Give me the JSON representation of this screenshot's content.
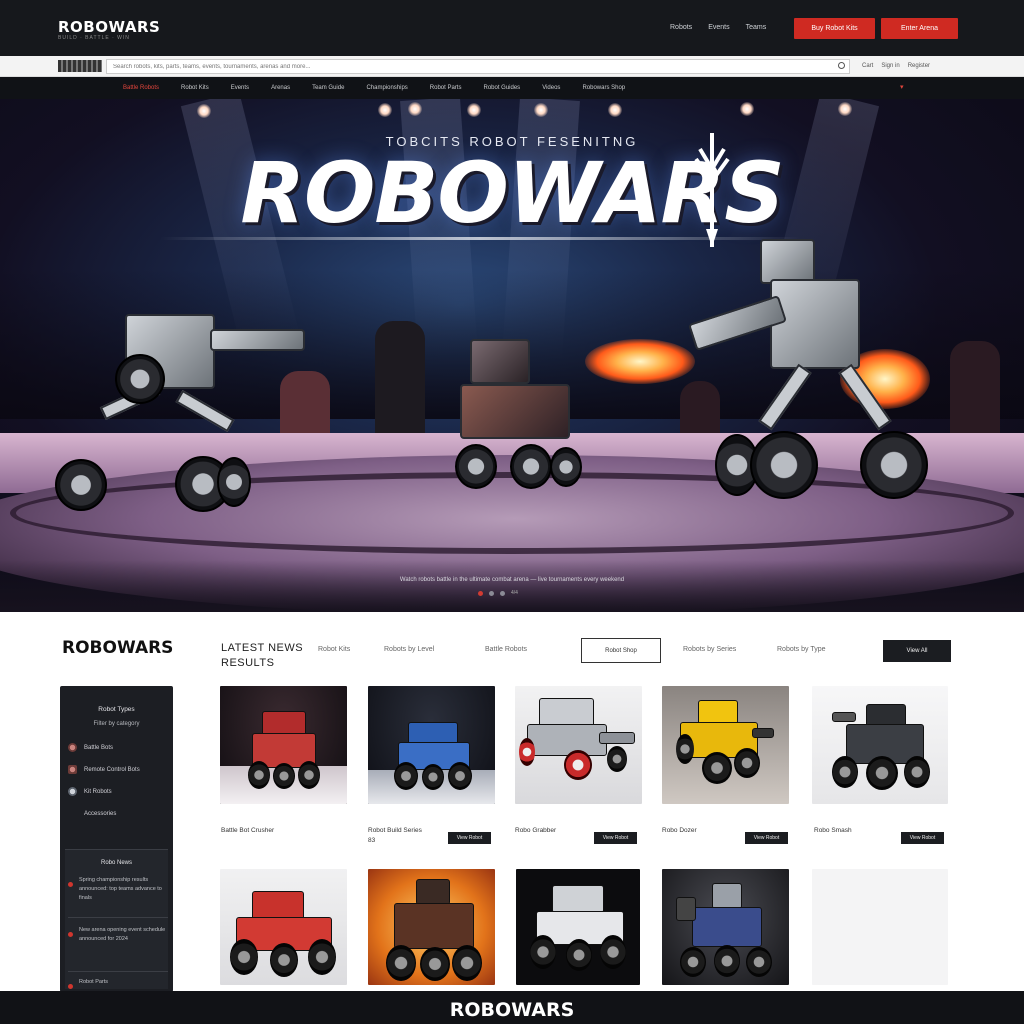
{
  "header": {
    "logo": "ROBOWARS",
    "logo_sub": "BUILD · BATTLE · WIN",
    "links": [
      "Robots",
      "Events",
      "Teams"
    ],
    "cta_primary": "Buy Robot Kits",
    "cta_secondary": "Enter Arena"
  },
  "search": {
    "placeholder": "Search robots, kits, parts, teams, events, tournaments, arenas and more...",
    "right_links": [
      "Cart",
      "Sign in",
      "Register"
    ]
  },
  "nav": {
    "items": [
      "Battle Robots",
      "Robot Kits",
      "Events",
      "Arenas",
      "Team Guide",
      "Championships",
      "Robot Parts",
      "Robot Guides",
      "Videos",
      "Robowars Shop"
    ],
    "active_index": 0
  },
  "hero": {
    "tagline": "TOBCITS ROBOT FESENITNG",
    "title": "ROBOWARS",
    "caption": "Watch robots battle in the ultimate combat arena — live tournaments every weekend",
    "slides": 4,
    "active_slide": 0,
    "slide_label": "4/4"
  },
  "section": {
    "logo": "ROBOWARS",
    "title_line1": "LATEST NEWS",
    "title_line2": "RESULTS",
    "filters": [
      "Robot Kits",
      "Robots by Level",
      "Battle Robots",
      "Robots by Series",
      "Robots by Type"
    ],
    "outline_button": "Robot Shop",
    "dark_button": "View All"
  },
  "sidebar": {
    "heading": "Robot Types",
    "subheading": "Filter by category",
    "items": [
      "Battle Bots",
      "Remote Control Bots",
      "Kit Robots",
      "Accessories"
    ],
    "news_heading": "Robo News",
    "news": [
      "Spring championship results announced: top teams advance to finals",
      "New arena opening event schedule announced for 2024",
      "Robot Parts"
    ]
  },
  "products": [
    {
      "name": "Battle Bot Crusher",
      "sub": "",
      "button": "View Robot"
    },
    {
      "name": "Robot Build Series",
      "sub": "83",
      "button": "View Robot"
    },
    {
      "name": "Robo Grabber",
      "sub": "",
      "button": "View Robot"
    },
    {
      "name": "Robo Dozer",
      "sub": "",
      "button": "View Robot"
    },
    {
      "name": "Robo Smash",
      "sub": "",
      "button": "View Robot"
    }
  ],
  "footer": {
    "logo": "ROBOWARS"
  }
}
